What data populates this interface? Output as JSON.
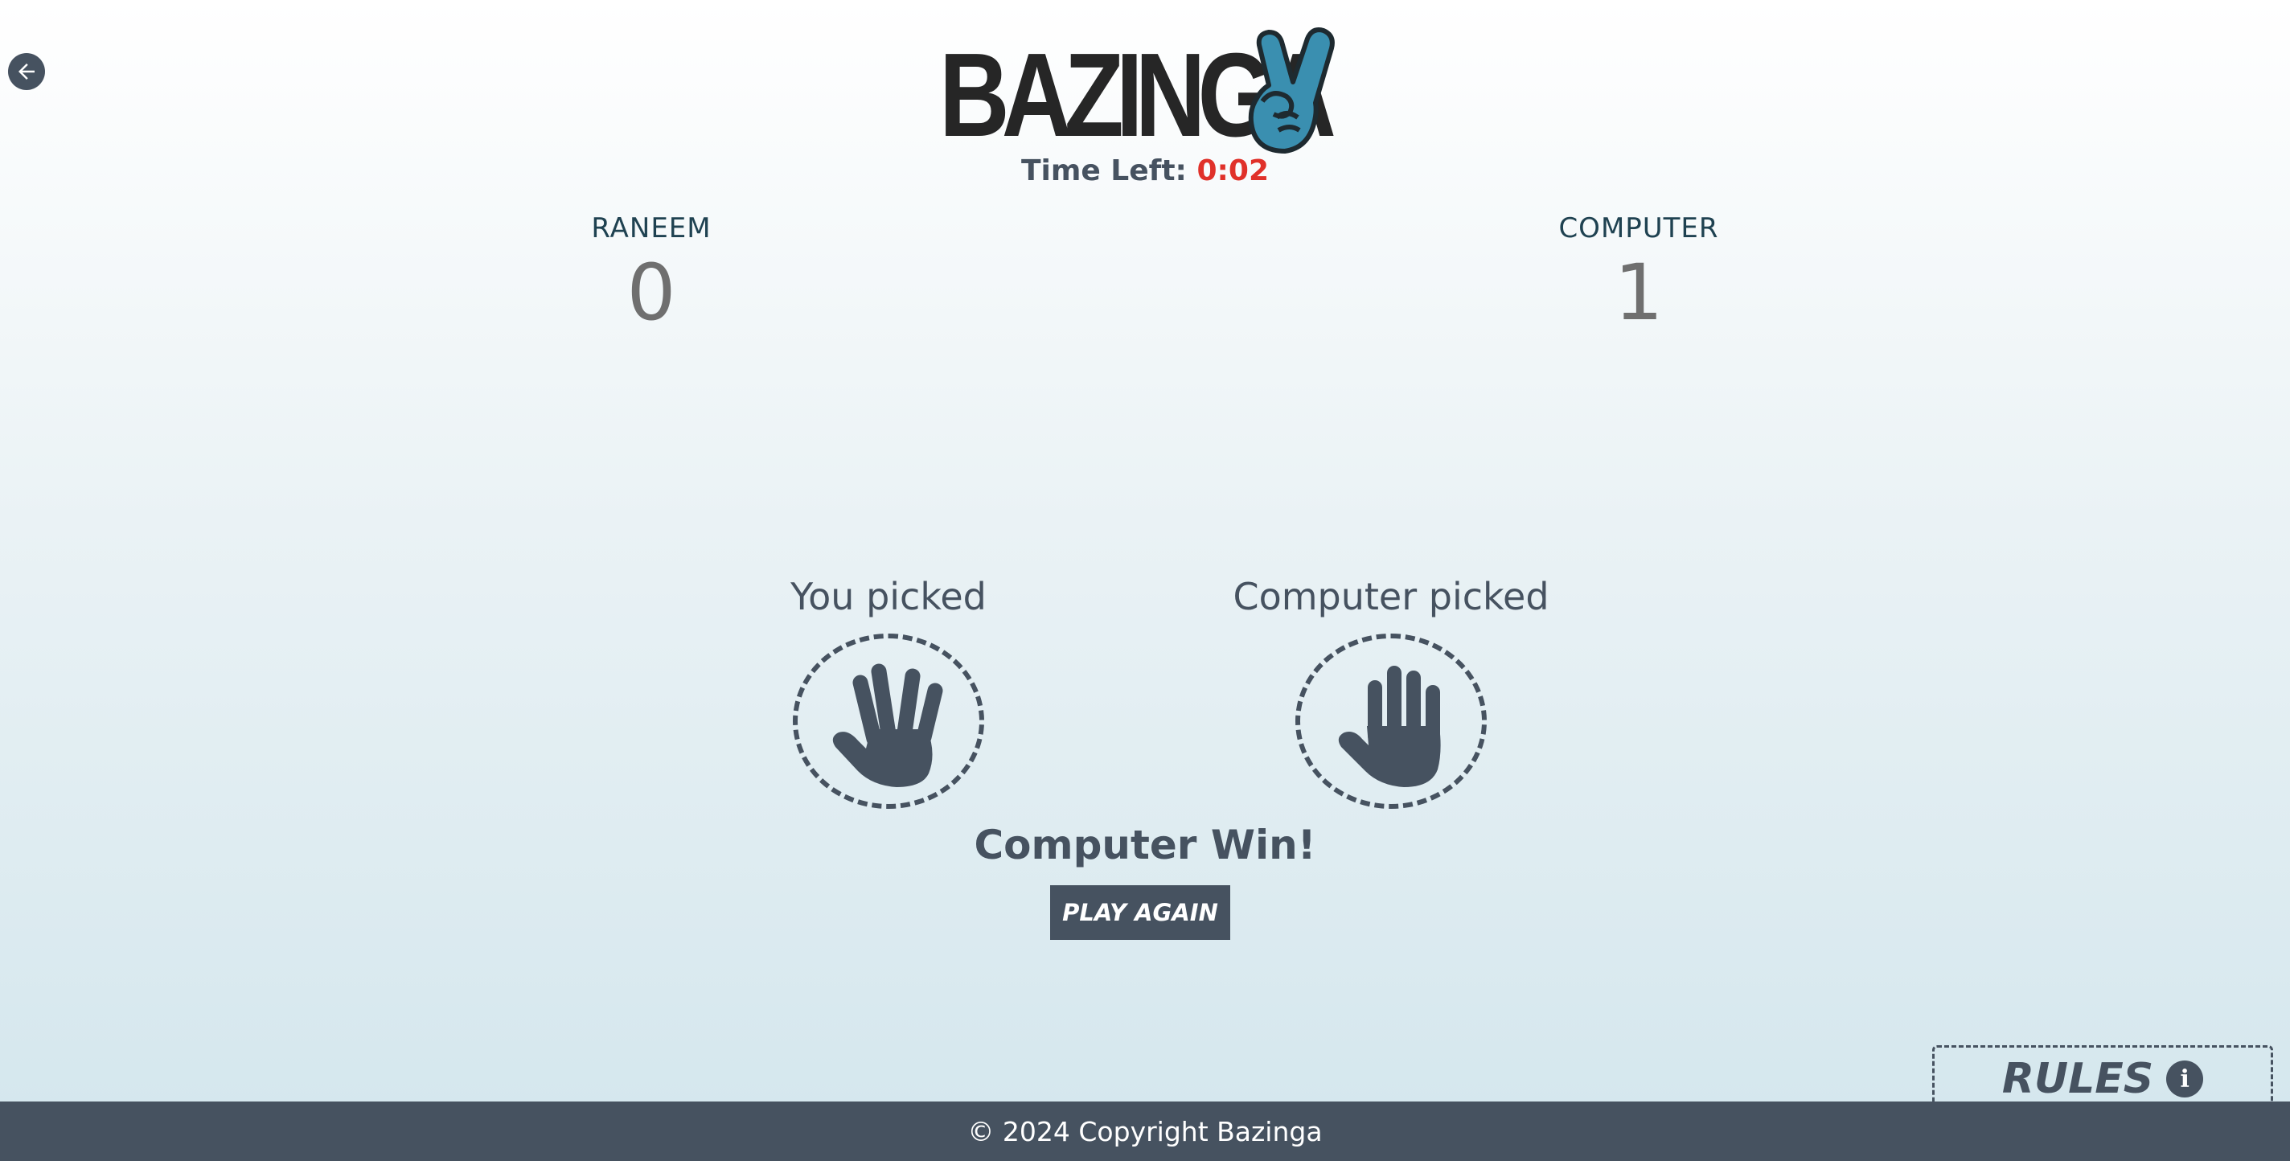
{
  "nav": {
    "back_icon": "arrow-left-icon"
  },
  "brand": {
    "name": "BAZINGA",
    "logo_icon": "peace-hand-icon",
    "accent": "#3a8fb0"
  },
  "timer": {
    "label": "Time Left:",
    "value": "0:02",
    "value_color": "#e0312a"
  },
  "scores": {
    "player": {
      "name": "RANEEM",
      "score": "0"
    },
    "computer": {
      "name": "COMPUTER",
      "score": "1"
    }
  },
  "picks": {
    "player": {
      "label": "You picked",
      "choice_icon": "spock-hand-icon"
    },
    "computer": {
      "label": "Computer picked",
      "choice_icon": "paper-hand-icon"
    }
  },
  "result": {
    "text": "Computer Win!"
  },
  "actions": {
    "play_again": "PLAY AGAIN"
  },
  "rules": {
    "label": "RULES",
    "icon": "info-icon",
    "glyph": "i"
  },
  "footer": {
    "text": "© 2024 Copyright Bazinga"
  },
  "colors": {
    "dark": "#465260",
    "footer_bg": "#465260",
    "score_value": "#6f6f6f"
  }
}
